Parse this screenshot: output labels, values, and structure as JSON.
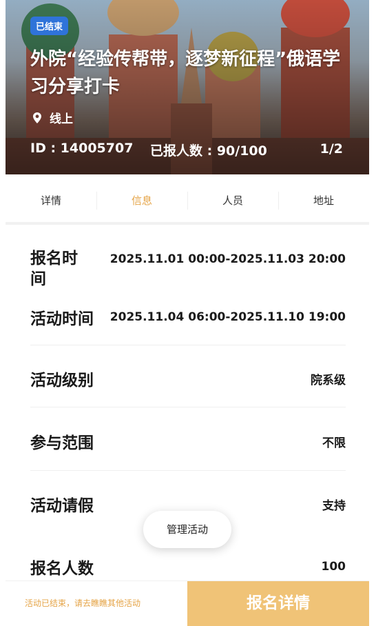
{
  "hero": {
    "status_badge": "已结束",
    "title": "外院“经验传帮带，逐梦新征程”俄语学习分享打卡",
    "location": "线上",
    "id_text": "ID : 14005707",
    "signed_text": "已报人数 : 90/100",
    "pager": "1/2",
    "image_icon": "st-basils-cathedral-photo"
  },
  "tabs": [
    {
      "label": "详情"
    },
    {
      "label": "信息"
    },
    {
      "label": "人员"
    },
    {
      "label": "地址"
    }
  ],
  "active_tab": "信息",
  "info": {
    "signup_time": {
      "label": "报名时间",
      "value": "2025.11.01 00:00-2025.11.03 20:00"
    },
    "activity_time": {
      "label": "活动时间",
      "value": "2025.11.04 06:00-2025.11.10 19:00"
    },
    "level": {
      "label": "活动级别",
      "value": "院系级"
    },
    "scope": {
      "label": "参与范围",
      "value": "不限"
    },
    "leave": {
      "label": "活动请假",
      "value": "支持"
    },
    "count": {
      "label": "报名人数",
      "value": "100"
    }
  },
  "manage_button": "管理活动",
  "bottom": {
    "tip": "活动已结束，请去瞧瞧其他活动",
    "signup_button": "报名详情"
  },
  "colors": {
    "accent": "#e5a447",
    "signup_bg": "#f0c377",
    "badge_bg": "#2f73d9"
  }
}
